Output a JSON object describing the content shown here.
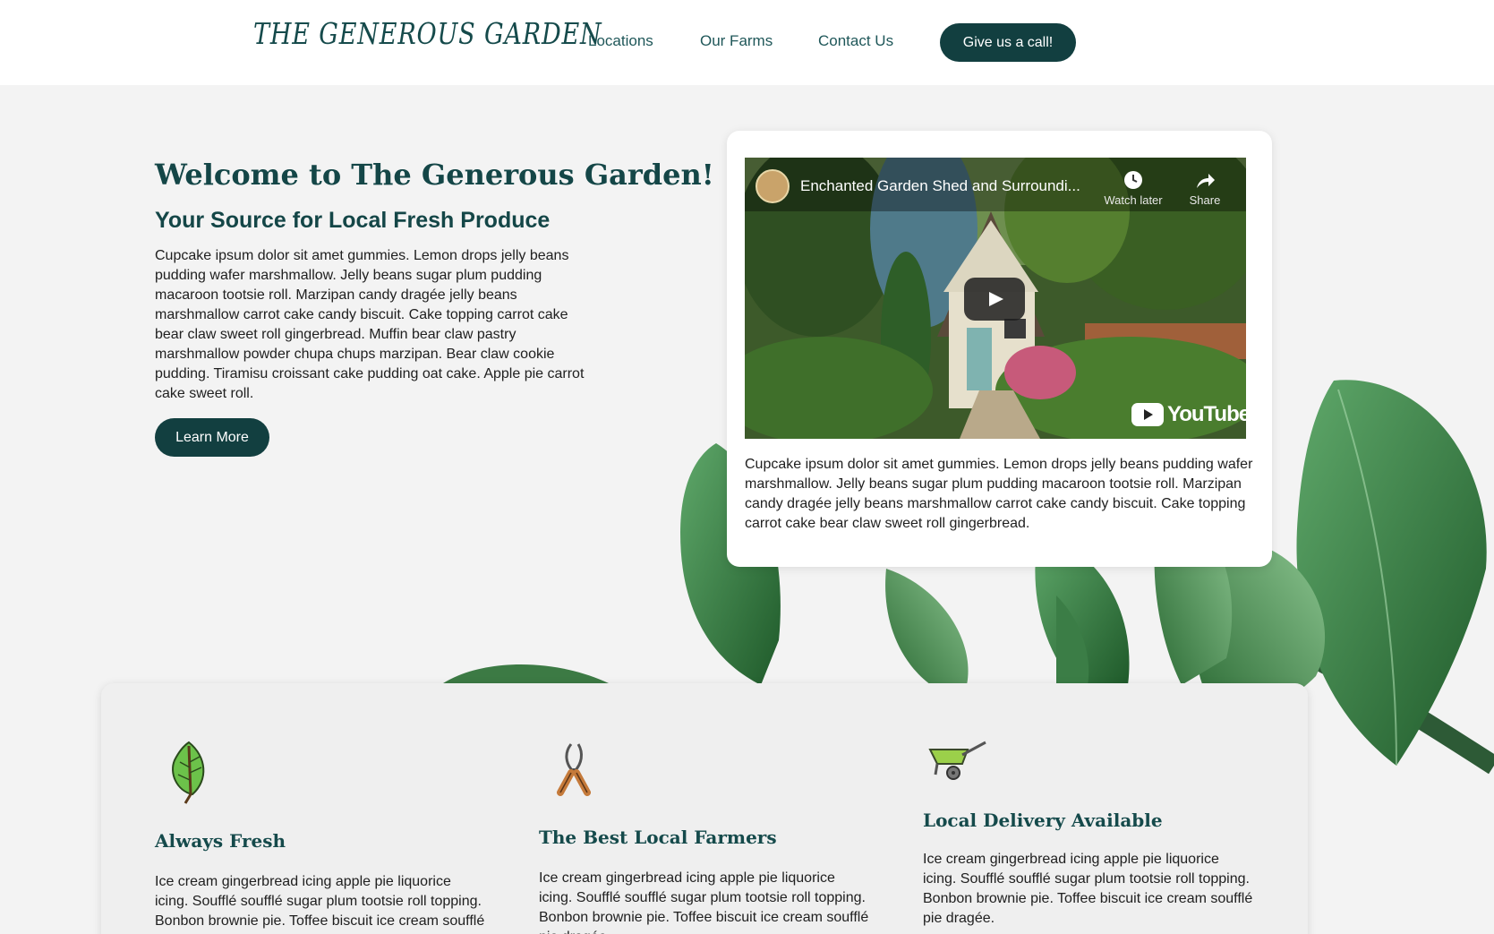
{
  "header": {
    "logo": "THE GENEROUS GARDEN",
    "nav": [
      "Locations",
      "Our Farms",
      "Contact Us"
    ],
    "cta_label": "Give us a call!"
  },
  "hero": {
    "title": "Welcome to The Generous Garden!",
    "subtitle": "Your Source for Local Fresh Produce",
    "body": "Cupcake ipsum dolor sit amet gummies. Lemon drops jelly beans pudding wafer marshmallow. Jelly beans sugar plum pudding macaroon tootsie roll. Marzipan candy dragée jelly beans marshmallow carrot cake candy biscuit. Cake topping carrot cake bear claw sweet roll gingerbread. Muffin bear claw pastry marshmallow powder chupa chups marzipan. Bear claw cookie pudding. Tiramisu croissant cake pudding oat cake. Apple pie carrot cake sweet roll.",
    "button_label": "Learn More"
  },
  "video": {
    "title": "Enchanted Garden Shed and Surroundi...",
    "watch_later": "Watch later",
    "share": "Share",
    "brand": "YouTube",
    "description": "Cupcake ipsum dolor sit amet gummies. Lemon drops jelly beans pudding wafer marshmallow. Jelly beans sugar plum pudding macaroon tootsie roll. Marzipan candy dragée jelly beans marshmallow carrot cake candy biscuit. Cake topping carrot cake bear claw sweet roll gingerbread."
  },
  "features": [
    {
      "icon": "leaf-icon",
      "title": "Always Fresh",
      "body": "Ice cream gingerbread icing apple pie liquorice icing. Soufflé soufflé sugar plum tootsie roll topping. Bonbon brownie pie. Toffee biscuit ice cream soufflé pie dragée."
    },
    {
      "icon": "pruning-shears-icon",
      "title": "The Best Local Farmers",
      "body": "Ice cream gingerbread icing apple pie liquorice icing. Soufflé soufflé sugar plum tootsie roll topping. Bonbon brownie pie. Toffee biscuit ice cream soufflé pie dragée."
    },
    {
      "icon": "wheelbarrow-icon",
      "title": "Local Delivery Available",
      "body": "Ice cream gingerbread icing apple pie liquorice icing. Soufflé soufflé sugar plum tootsie roll topping. Bonbon brownie pie. Toffee biscuit ice cream soufflé pie dragée."
    }
  ],
  "colors": {
    "brand_dark": "#123f40",
    "heading": "#144647",
    "leaf_green": "#2f7a3a"
  }
}
